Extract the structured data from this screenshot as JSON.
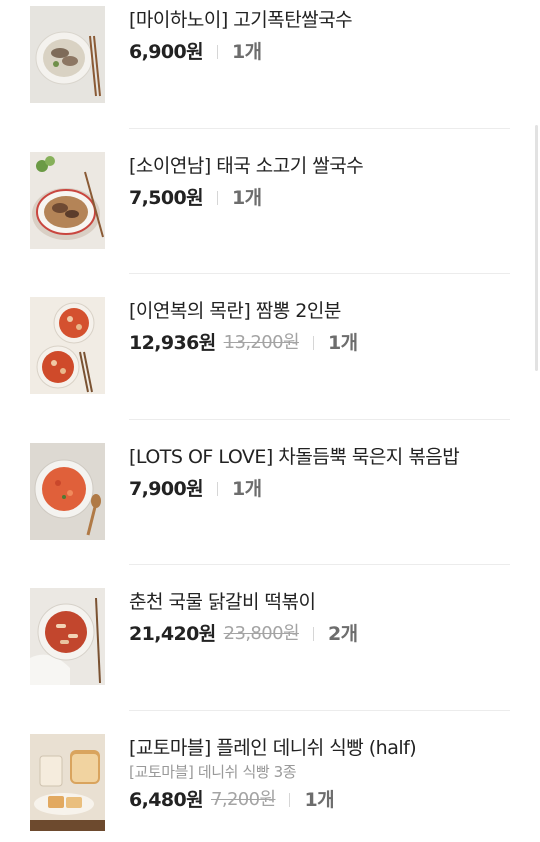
{
  "order_items": [
    {
      "title": "[마이하노이] 고기폭탄쌀국수",
      "subtitle": "",
      "price": "6,900원",
      "original_price": "",
      "quantity": "1개",
      "image": "beef-pho-bowl"
    },
    {
      "title": "[소이연남] 태국 소고기 쌀국수",
      "subtitle": "",
      "price": "7,500원",
      "original_price": "",
      "quantity": "1개",
      "image": "thai-beef-noodle-bowl"
    },
    {
      "title": "[이연복의 목란] 짬뽕 2인분",
      "subtitle": "",
      "price": "12,936원",
      "original_price": "13,200원",
      "quantity": "1개",
      "image": "jjamppong-bowls"
    },
    {
      "title": "[LOTS OF LOVE] 차돌듬뿍 묵은지 볶음밥",
      "subtitle": "",
      "price": "7,900원",
      "original_price": "",
      "quantity": "1개",
      "image": "kimchi-fried-rice-plate"
    },
    {
      "title": "춘천 국물 닭갈비 떡볶이",
      "subtitle": "",
      "price": "21,420원",
      "original_price": "23,800원",
      "quantity": "2개",
      "image": "dakgalbi-tteokbokki-bowl"
    },
    {
      "title": "[교토마블] 플레인 데니쉬 식빵 (half)",
      "subtitle": "[교토마블] 데니쉬 식빵 3종",
      "price": "6,480원",
      "original_price": "7,200원",
      "quantity": "1개",
      "image": "danish-bread-loaf"
    }
  ]
}
